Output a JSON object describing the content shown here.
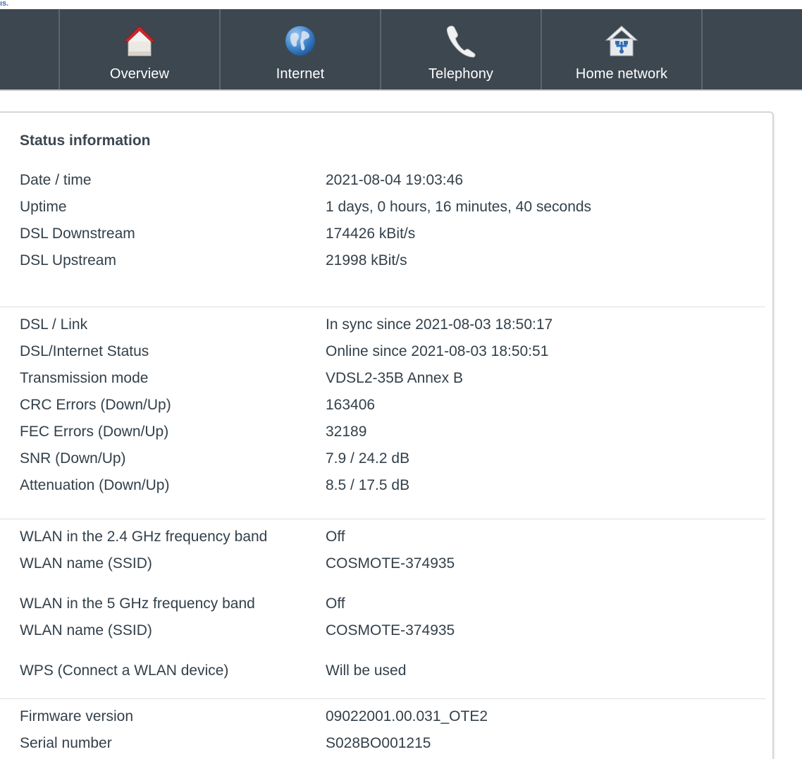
{
  "corner_text": "ıs.",
  "nav": {
    "items": [
      {
        "label": "Overview"
      },
      {
        "label": "Internet"
      },
      {
        "label": "Telephony"
      },
      {
        "label": "Home network"
      }
    ]
  },
  "status": {
    "title": "Status information",
    "general": [
      {
        "label": "Date / time",
        "value": "2021-08-04 19:03:46"
      },
      {
        "label": "Uptime",
        "value": "1 days, 0 hours, 16 minutes, 40 seconds"
      },
      {
        "label": "DSL Downstream",
        "value": "174426 kBit/s"
      },
      {
        "label": "DSL Upstream",
        "value": "21998 kBit/s"
      }
    ],
    "dsl": [
      {
        "label": "DSL / Link",
        "value": "In sync since 2021-08-03 18:50:17"
      },
      {
        "label": "DSL/Internet Status",
        "value": "Online since 2021-08-03 18:50:51"
      },
      {
        "label": "Transmission mode",
        "value": "VDSL2-35B Annex B"
      },
      {
        "label": "CRC Errors (Down/Up)",
        "value": "163406"
      },
      {
        "label": "FEC Errors (Down/Up)",
        "value": "32189"
      },
      {
        "label": "SNR (Down/Up)",
        "value": "7.9 / 24.2 dB"
      },
      {
        "label": "Attenuation (Down/Up)",
        "value": "8.5 / 17.5 dB"
      }
    ],
    "wlan": [
      {
        "label": "WLAN in the 2.4 GHz frequency band",
        "value": "Off"
      },
      {
        "label": "WLAN name (SSID)",
        "value": "COSMOTE-374935"
      },
      {
        "label": "WLAN in the 5 GHz frequency band",
        "value": "Off"
      },
      {
        "label": "WLAN name (SSID)",
        "value": "COSMOTE-374935"
      },
      {
        "label": "WPS (Connect a WLAN device)",
        "value": "Will be used"
      }
    ],
    "device": [
      {
        "label": "Firmware version",
        "value": "09022001.00.031_OTE2"
      },
      {
        "label": "Serial number",
        "value": "S028BO001215"
      }
    ]
  },
  "colors": {
    "navbar_bg": "#3d4750",
    "text": "#33404a",
    "accent_red": "#c8282d",
    "globe_blue": "#2f6db5"
  }
}
